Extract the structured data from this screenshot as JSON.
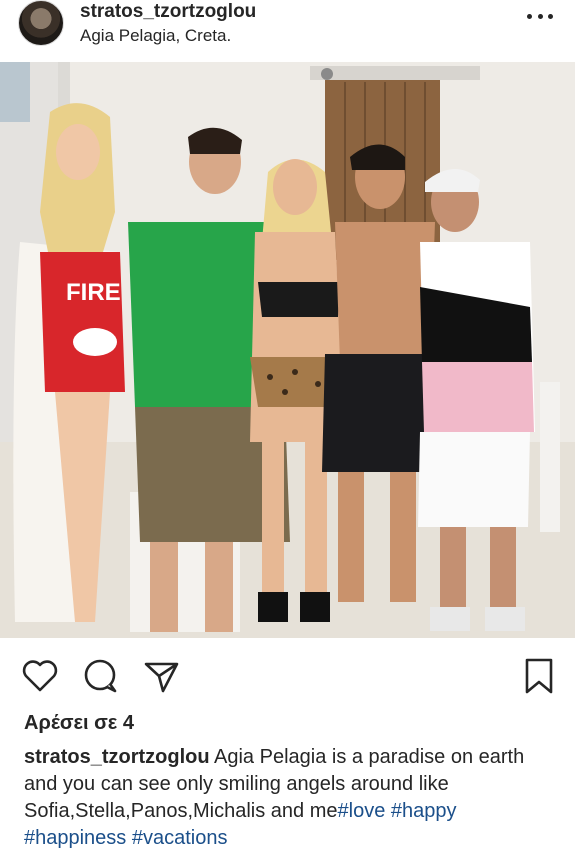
{
  "post": {
    "username": "stratos_tzortzoglou",
    "location": "Agia Pelagia, Creta."
  },
  "icons": {
    "more": "more-options-icon",
    "like": "heart-icon",
    "comment": "comment-icon",
    "share": "send-icon",
    "save": "bookmark-icon"
  },
  "likes_text": "Αρέσει σε 4",
  "caption": {
    "username": "stratos_tzortzoglou",
    "text": " Agia Pelagia is a paradise on earth and you can see only smiling angels around like Sofia,Stella,Panos,Michalis and me",
    "hashtags": [
      "#love",
      "#happy",
      "#happiness",
      "#vacations"
    ]
  },
  "colors": {
    "text": "#262626",
    "hashtag": "#1b4f8a"
  }
}
